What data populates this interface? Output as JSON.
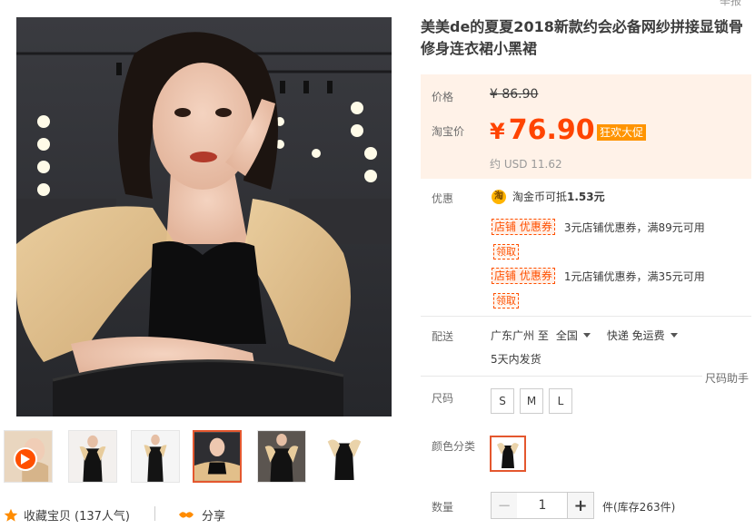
{
  "header": {
    "report_link": "举报"
  },
  "product": {
    "title": "美美de的夏夏2018新款约会必备网纱拼接显锁骨修身连衣裙小黑裙"
  },
  "price": {
    "price_label": "价格",
    "original_price": "¥ 86.90",
    "taobao_label": "淘宝价",
    "currency": "¥",
    "current_price": "76.90",
    "promo_badge": "狂欢大促",
    "usd_price": "约 USD 11.62"
  },
  "promotions": {
    "label": "优惠",
    "coin_icon": "淘",
    "coin_text": "淘金币可抵",
    "coin_amount": "1.53元",
    "coupons": [
      {
        "tag": "店铺 优惠券",
        "text": "3元店铺优惠券，满89元可用",
        "receive": "领取"
      },
      {
        "tag": "店铺 优惠券",
        "text": "1元店铺优惠券，满35元可用",
        "receive": "领取"
      }
    ]
  },
  "shipping": {
    "label": "配送",
    "origin": "广东广州 至",
    "destination": "全国",
    "method": "快递 免运费",
    "eta": "5天内发货"
  },
  "size_helper": "尺码助手",
  "size": {
    "label": "尺码",
    "options": [
      "S",
      "M",
      "L"
    ]
  },
  "color": {
    "label": "颜色分类"
  },
  "quantity": {
    "label": "数量",
    "minus": "−",
    "plus": "+",
    "value": "1",
    "unit": "件(库存263件)"
  },
  "gallery": {
    "thumbnail_count": 6,
    "active_thumbnail": 4,
    "favorite_label": "收藏宝贝",
    "favorite_count": "(137人气)",
    "share_label": "分享"
  },
  "colors": {
    "accent": "#ff4400",
    "badge": "#ff9400",
    "price_bg": "#fff2e8",
    "selected_border": "#e4572e"
  }
}
